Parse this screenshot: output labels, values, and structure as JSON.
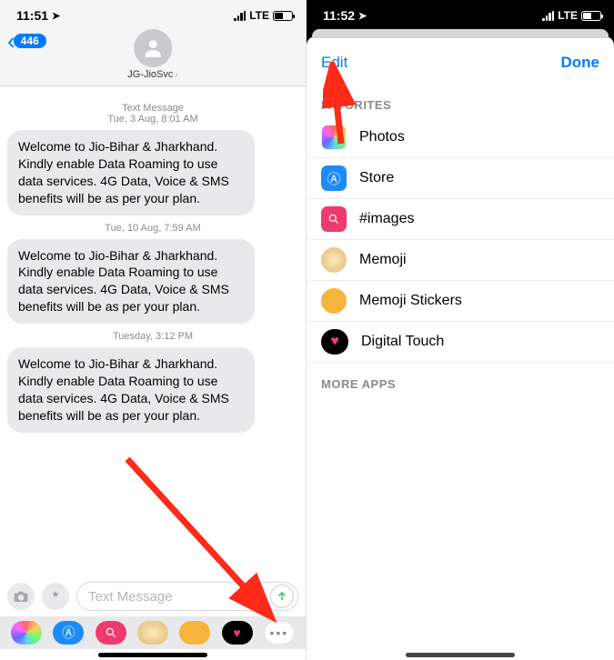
{
  "left": {
    "status": {
      "time": "11:51",
      "net": "LTE"
    },
    "back_count": "446",
    "contact_name": "JG-JioSvc",
    "section_label": "Text Message",
    "timestamps": [
      "Tue, 3 Aug, 8:01 AM",
      "Tue, 10 Aug, 7:59 AM",
      "Tuesday, 3:12 PM"
    ],
    "message_text": "Welcome to Jio-Bihar & Jharkhand. Kindly enable Data Roaming to use data services. 4G Data, Voice & SMS benefits will be as per your plan.",
    "compose_placeholder": "Text Message",
    "app_strip": [
      "Photos",
      "Store",
      "#images",
      "Memoji",
      "Stickers",
      "Digital",
      "More"
    ]
  },
  "right": {
    "status": {
      "time": "11:52",
      "net": "LTE"
    },
    "edit": "Edit",
    "done": "Done",
    "favorites_header": "FAVORITES",
    "favorites": [
      {
        "name": "Photos",
        "icon": "photos"
      },
      {
        "name": "Store",
        "icon": "store"
      },
      {
        "name": "#images",
        "icon": "images"
      },
      {
        "name": "Memoji",
        "icon": "memoji"
      },
      {
        "name": "Memoji Stickers",
        "icon": "stickers"
      },
      {
        "name": "Digital Touch",
        "icon": "digital"
      }
    ],
    "more_header": "MORE APPS"
  }
}
